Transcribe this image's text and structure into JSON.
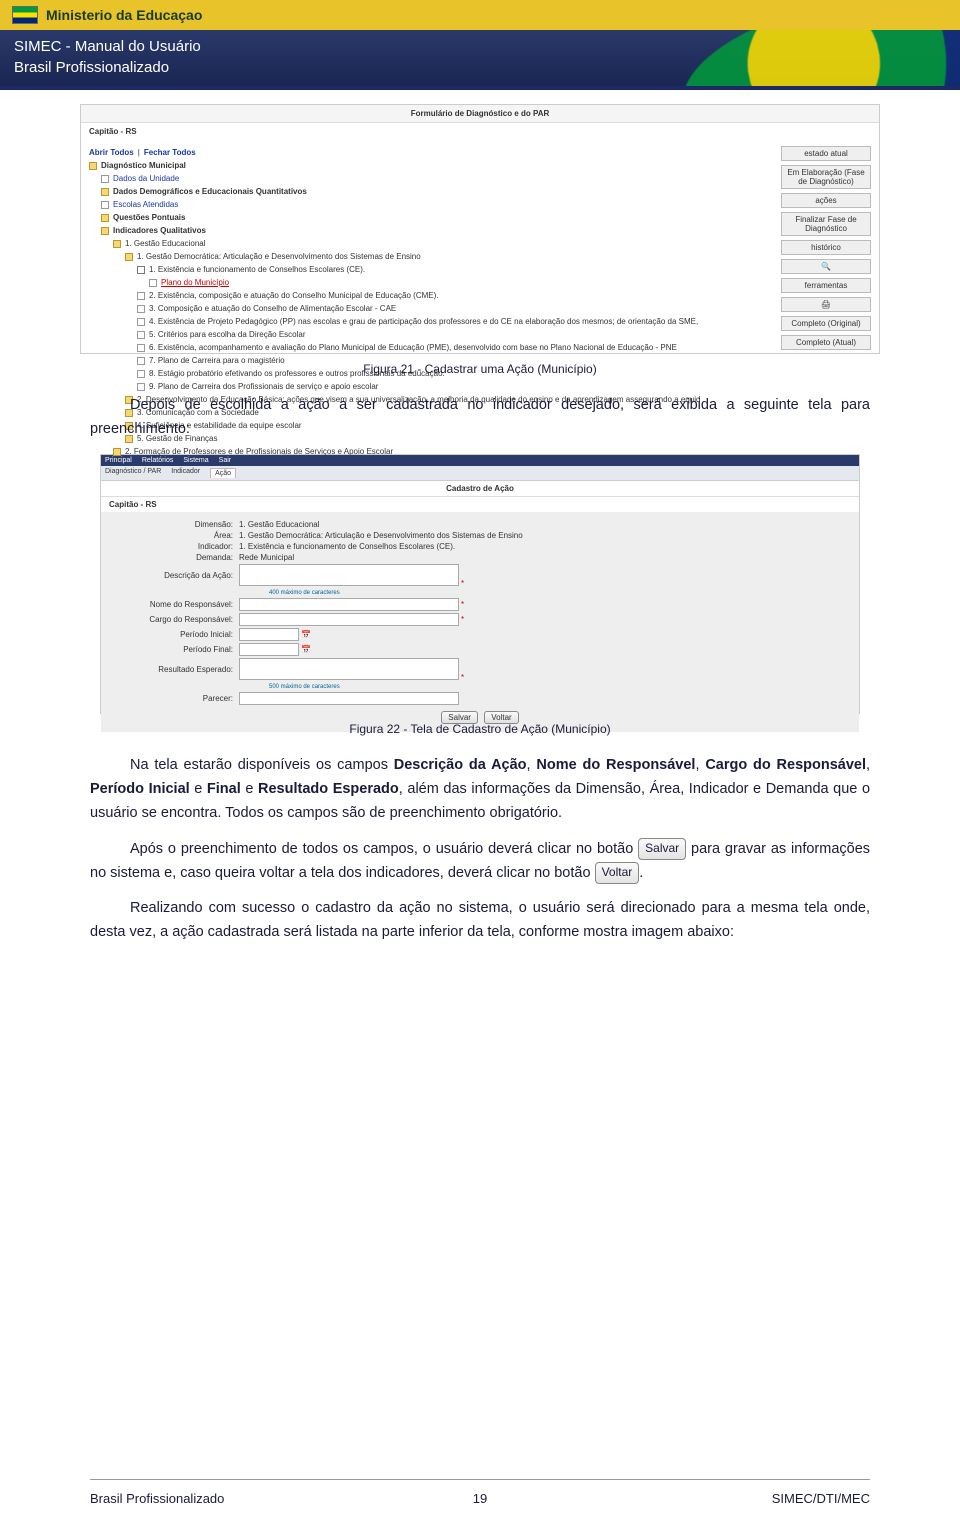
{
  "header": {
    "ministry": "Ministerio da Educaçao",
    "system": "SIMEC - Manual do Usuário",
    "program": "Brasil Profissionalizado"
  },
  "figure1": {
    "title": "Formulário de Diagnóstico e do PAR",
    "header_region": "Capitão - RS",
    "links": {
      "abrir": "Abrir Todos",
      "fechar": "Fechar Todos"
    },
    "tree": {
      "root": "Diagnóstico Municipal",
      "items": [
        "Dados da Unidade",
        "Dados Demográficos e Educacionais Quantitativos",
        "Escolas Atendidas",
        "Questões Pontuais",
        "Indicadores Qualitativos"
      ],
      "dim1": "1. Gestão Educacional",
      "sub1": "1. Gestão Democrática: Articulação e Desenvolvimento dos Sistemas de Ensino",
      "pts": [
        "1. Existência e funcionamento de Conselhos Escolares (CE).",
        "Plano do Município",
        "2. Existência, composição e atuação do Conselho Municipal de Educação (CME).",
        "3. Composição e atuação do Conselho de Alimentação Escolar - CAE",
        "4. Existência de Projeto Pedagógico (PP) nas escolas e grau de participação dos professores e do CE na elaboração dos mesmos; de orientação da SME,",
        "5. Critérios para escolha da Direção Escolar",
        "6. Existência, acompanhamento e avaliação do Plano Municipal de Educação (PME), desenvolvido com base no Plano Nacional de Educação - PNE",
        "7. Plano de Carreira para o magistério",
        "8. Estágio probatório efetivando os professores e outros profissionais da educação.",
        "9. Plano de Carreira dos Profissionais de serviço e apoio escolar"
      ],
      "sub_items": [
        "2. Desenvolvimento da Educação Básica: ações que visem a sua universalização, a melhoria da qualidade do ensino e da aprendizagem assegurando a equid",
        "3. Comunicação com a Sociedade",
        "4. Suficiência e estabilidade da equipe escolar",
        "5. Gestão de Finanças"
      ],
      "dim2": "2. Formação de Professores e de Profissionais de Serviços e Apoio Escolar"
    },
    "side": {
      "estado_title": "estado atual",
      "estado_value": "Em Elaboração (Fase de Diagnóstico)",
      "acoes_title": "ações",
      "acao1": "Finalizar Fase de Diagnóstico",
      "hist_title": "histórico",
      "ferr_title": "ferramentas",
      "tool1": "Completo (Original)",
      "tool2": "Completo (Atual)"
    }
  },
  "caption1": "Figura 21 - Cadastrar uma Ação (Município)",
  "para1": "Depois de escolhida a ação a ser cadastrada no indicador desejado, será exibida a seguinte tela para preenchimento:",
  "figure2": {
    "nav": [
      "Principal",
      "Relatórios",
      "Sistema",
      "Sair"
    ],
    "tabs": [
      "Diagnóstico / PAR",
      "Indicador",
      "Ação"
    ],
    "subtitle": "Cadastro de Ação",
    "region": "Capitão - RS",
    "fields": {
      "dimensao_lbl": "Dimensão:",
      "dimensao_val": "1. Gestão Educacional",
      "area_lbl": "Área:",
      "area_val": "1. Gestão Democrática: Articulação e Desenvolvimento dos Sistemas de Ensino",
      "indicador_lbl": "Indicador:",
      "indicador_val": "1. Existência e funcionamento de Conselhos Escolares (CE).",
      "demanda_lbl": "Demanda:",
      "demanda_val": "Rede Municipal",
      "descacao_lbl": "Descrição da Ação:",
      "hint_400": "400 máximo de caracteres",
      "nomeresp_lbl": "Nome do Responsável:",
      "cargoresp_lbl": "Cargo do Responsável:",
      "pini_lbl": "Período Inicial:",
      "pfim_lbl": "Período Final:",
      "result_lbl": "Resultado Esperado:",
      "hint_500": "500 máximo de caracteres",
      "parecer_lbl": "Parecer:"
    },
    "buttons": {
      "salvar": "Salvar",
      "voltar": "Voltar"
    }
  },
  "caption2": "Figura 22 - Tela de Cadastro de Ação (Município)",
  "para2_a": "Na tela estarão disponíveis os campos ",
  "bold": {
    "b1": "Descrição da Ação",
    "b2": "Nome do Responsável",
    "b3": "Cargo do Responsável",
    "b4": "Período Inicial",
    "b5": "Final",
    "b6": "Resultado Esperado"
  },
  "para2_b": ", além das informações da Dimensão, Área, Indicador e Demanda que o usuário se encontra. Todos os campos são de preenchimento obrigatório.",
  "para3_a": "Após o preenchimento de todos os campos, o usuário deverá clicar no botão ",
  "para3_b": " para gravar as informações no sistema e, caso queira voltar a tela dos indicadores, deverá clicar no botão ",
  "btn_salvar": "Salvar",
  "btn_voltar": "Voltar",
  "para4": "Realizando com sucesso o cadastro da ação no sistema, o usuário será direcionado para a mesma tela onde, desta vez, a ação cadastrada será listada na parte inferior da tela, conforme mostra imagem abaixo:",
  "footer": {
    "left": "Brasil Profissionalizado",
    "center": "19",
    "right": "SIMEC/DTI/MEC"
  }
}
